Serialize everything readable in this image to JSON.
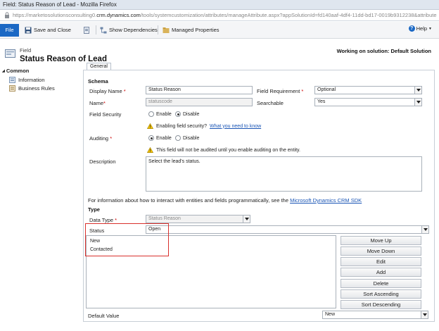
{
  "window": {
    "title": "Field: Status Reason of Lead - Mozilla Firefox",
    "url_prefix": "https://marketosolutionsconsulting0.",
    "url_host": "crm.dynamics.com",
    "url_suffix": "/tools/systemcustomization/attributes/manageAttribute.aspx?appSolutionId=fd140aaf-4df4-11dd-bd17-0019b9312238&attribute"
  },
  "toolbar": {
    "file_label": "File",
    "save_close_label": "Save and Close",
    "show_dependencies_label": "Show Dependencies",
    "managed_properties_label": "Managed Properties",
    "help_label": "Help"
  },
  "header": {
    "kind": "Field",
    "title": "Status Reason of Lead",
    "solution": "Working on solution: Default Solution"
  },
  "nav": {
    "group": "Common",
    "items": [
      {
        "label": "Information"
      },
      {
        "label": "Business Rules"
      }
    ]
  },
  "tabs": [
    "General"
  ],
  "schema": {
    "section_label": "Schema",
    "display_name_label": "Display Name",
    "display_name_value": "Status Reason",
    "field_requirement_label": "Field Requirement",
    "field_requirement_value": "Optional",
    "name_label": "Name",
    "name_value": "statuscode",
    "searchable_label": "Searchable",
    "searchable_value": "Yes",
    "field_security_label": "Field Security",
    "enable_label": "Enable",
    "disable_label": "Disable",
    "field_security_warning": "Enabling field security?",
    "field_security_link": "What you need to know",
    "auditing_label": "Auditing",
    "auditing_warning": "This field will not be audited until you enable auditing on the entity.",
    "description_label": "Description",
    "description_value": "Select the lead's status.",
    "sdk_text": "For information about how to interact with entities and fields programmatically, see the",
    "sdk_link": "Microsoft Dynamics CRM SDK"
  },
  "type": {
    "section_label": "Type",
    "data_type_label": "Data Type",
    "data_type_value": "Status Reason",
    "status_label": "Status",
    "status_value": "Open",
    "options": [
      "New",
      "Contacted"
    ],
    "buttons": [
      "Move Up",
      "Move Down",
      "Edit",
      "Add",
      "Delete",
      "Sort Ascending",
      "Sort Descending"
    ],
    "default_value_label": "Default Value",
    "default_value_value": "New"
  },
  "colors": {
    "accent": "#1b68c4",
    "highlight_box": "#d9302c",
    "link": "#1a55b5"
  },
  "radio_state": {
    "field_security": "Disable",
    "auditing": "Enable"
  }
}
